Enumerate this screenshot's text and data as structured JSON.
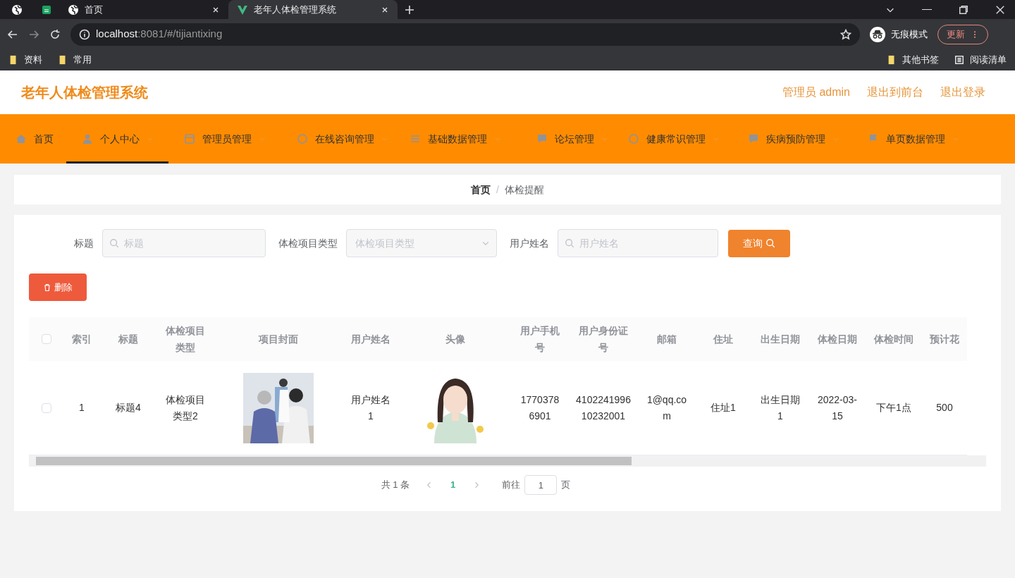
{
  "browser": {
    "tabs": [
      {
        "title": "首页",
        "selected": false
      },
      {
        "title": "老年人体检管理系统",
        "selected": true
      }
    ],
    "address": {
      "host": "localhost",
      "path": ":8081/#/tijiantixing"
    },
    "incognito": "无痕模式",
    "update": "更新",
    "bookmarks": [
      "资料",
      "常用"
    ],
    "bookmarks_right": [
      "其他书签",
      "阅读清单"
    ]
  },
  "header": {
    "title": "老年人体检管理系统",
    "links": [
      "管理员 admin",
      "退出到前台",
      "退出登录"
    ]
  },
  "nav": [
    {
      "label": "首页",
      "kind": "home",
      "selected": false,
      "dropdown": false
    },
    {
      "label": "个人中心",
      "kind": "user",
      "selected": true,
      "dropdown": true
    },
    {
      "label": "管理员管理",
      "kind": "box",
      "selected": false,
      "dropdown": true
    },
    {
      "label": "在线咨询管理",
      "kind": "circle",
      "selected": false,
      "dropdown": true
    },
    {
      "label": "基础数据管理",
      "kind": "list",
      "selected": false,
      "dropdown": true
    },
    {
      "label": "论坛管理",
      "kind": "chat",
      "selected": false,
      "dropdown": true
    },
    {
      "label": "健康常识管理",
      "kind": "circle",
      "selected": false,
      "dropdown": true
    },
    {
      "label": "疾病预防管理",
      "kind": "chat",
      "selected": false,
      "dropdown": true
    },
    {
      "label": "单页数据管理",
      "kind": "flag",
      "selected": false,
      "dropdown": true
    }
  ],
  "breadcrumb": {
    "items": [
      "首页",
      "体检提醒"
    ],
    "separator": "/"
  },
  "search": [
    {
      "label": "标题",
      "kind": "input",
      "placeholder": "标题"
    },
    {
      "label": "体检项目类型",
      "kind": "select",
      "placeholder": "体检项目类型"
    },
    {
      "label": "用户姓名",
      "kind": "input",
      "placeholder": "用户姓名"
    }
  ],
  "search_button": "查询",
  "delete_button": "删除",
  "table": {
    "all_checked": false,
    "columns": [
      "索引",
      "标题",
      "体检项目类型",
      "项目封面",
      "用户姓名",
      "头像",
      "用户手机号",
      "用户身份证号",
      "邮箱",
      "住址",
      "出生日期",
      "体检日期",
      "体检时间",
      "预计花"
    ],
    "rows": [
      {
        "checked": false,
        "cells": [
          "1",
          "标题4",
          "体检项目类型2",
          {
            "kind": "picture"
          },
          "用户姓名1",
          {
            "kind": "picture"
          },
          "17703786901",
          "410224199610232001",
          "1@qq.com",
          "住址1",
          "出生日期1",
          "2022-03-15",
          "下午1点",
          "500"
        ]
      }
    ]
  },
  "pagination": {
    "total": "共 1 条",
    "pages": [
      {
        "label": "1",
        "selected": true
      }
    ],
    "goto_label": "前往",
    "goto_value": "1",
    "goto_suffix": "页"
  }
}
